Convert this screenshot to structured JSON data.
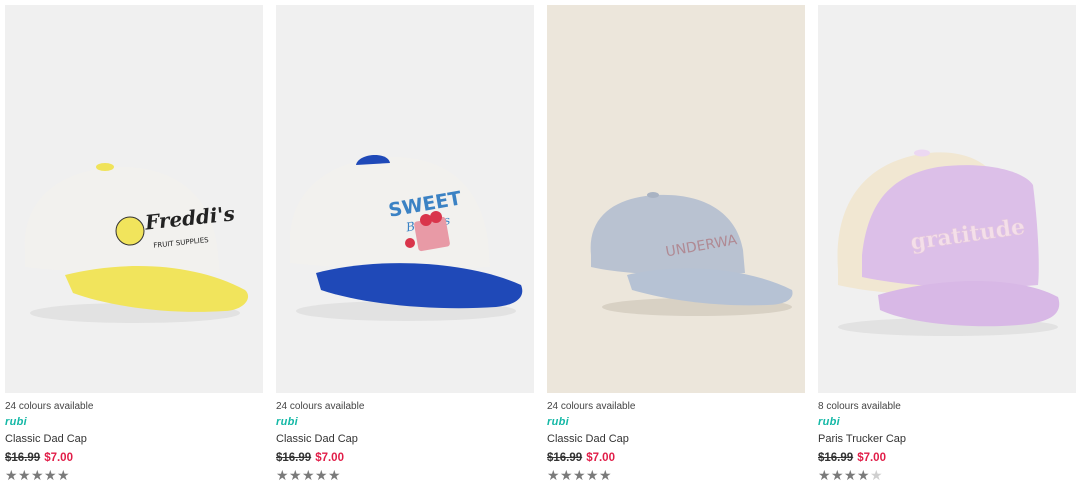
{
  "products": [
    {
      "colours": "24 colours available",
      "brand": "rubi",
      "title": "Classic Dad Cap",
      "old_price": "$16.99",
      "new_price": "$7.00",
      "rating": 4.5,
      "cap_text": "Freddi's",
      "cap_subtext": "FRUIT SUPPLIES",
      "colors": {
        "crown": "#f2f1ee",
        "brim": "#f1e45c",
        "button": "#f0e35a",
        "text": "#222222",
        "bg": "#f0f0f0"
      }
    },
    {
      "colours": "24 colours available",
      "brand": "rubi",
      "title": "Classic Dad Cap",
      "old_price": "$16.99",
      "new_price": "$7.00",
      "rating": 4.5,
      "cap_text": "SWEET",
      "cap_subtext": "Berries",
      "colors": {
        "crown": "#f2f1ee",
        "brim": "#1f49b8",
        "button": "#1f49b8",
        "text": "#3b82c4",
        "bg": "#f0f0f0"
      }
    },
    {
      "colours": "24 colours available",
      "brand": "rubi",
      "title": "Classic Dad Cap",
      "old_price": "$16.99",
      "new_price": "$7.00",
      "rating": 4.5,
      "cap_text": "UNDERWA",
      "cap_subtext": "",
      "colors": {
        "crown": "#b9c2d1",
        "brim": "#b6c2d4",
        "button": "#b9c2d1",
        "text": "#b08a94",
        "bg": "#ece6db"
      }
    },
    {
      "colours": "8 colours available",
      "brand": "rubi",
      "title": "Paris Trucker Cap",
      "old_price": "$16.99",
      "new_price": "$7.00",
      "rating": 4,
      "cap_text": "gratitude",
      "cap_subtext": "",
      "colors": {
        "crown": "#dcbfe8",
        "brim": "#d8b8e6",
        "button": "#dcbfe8",
        "mesh": "#f1e7d2",
        "text": "#f4dfe9",
        "bg": "#f0f0f0"
      }
    }
  ]
}
